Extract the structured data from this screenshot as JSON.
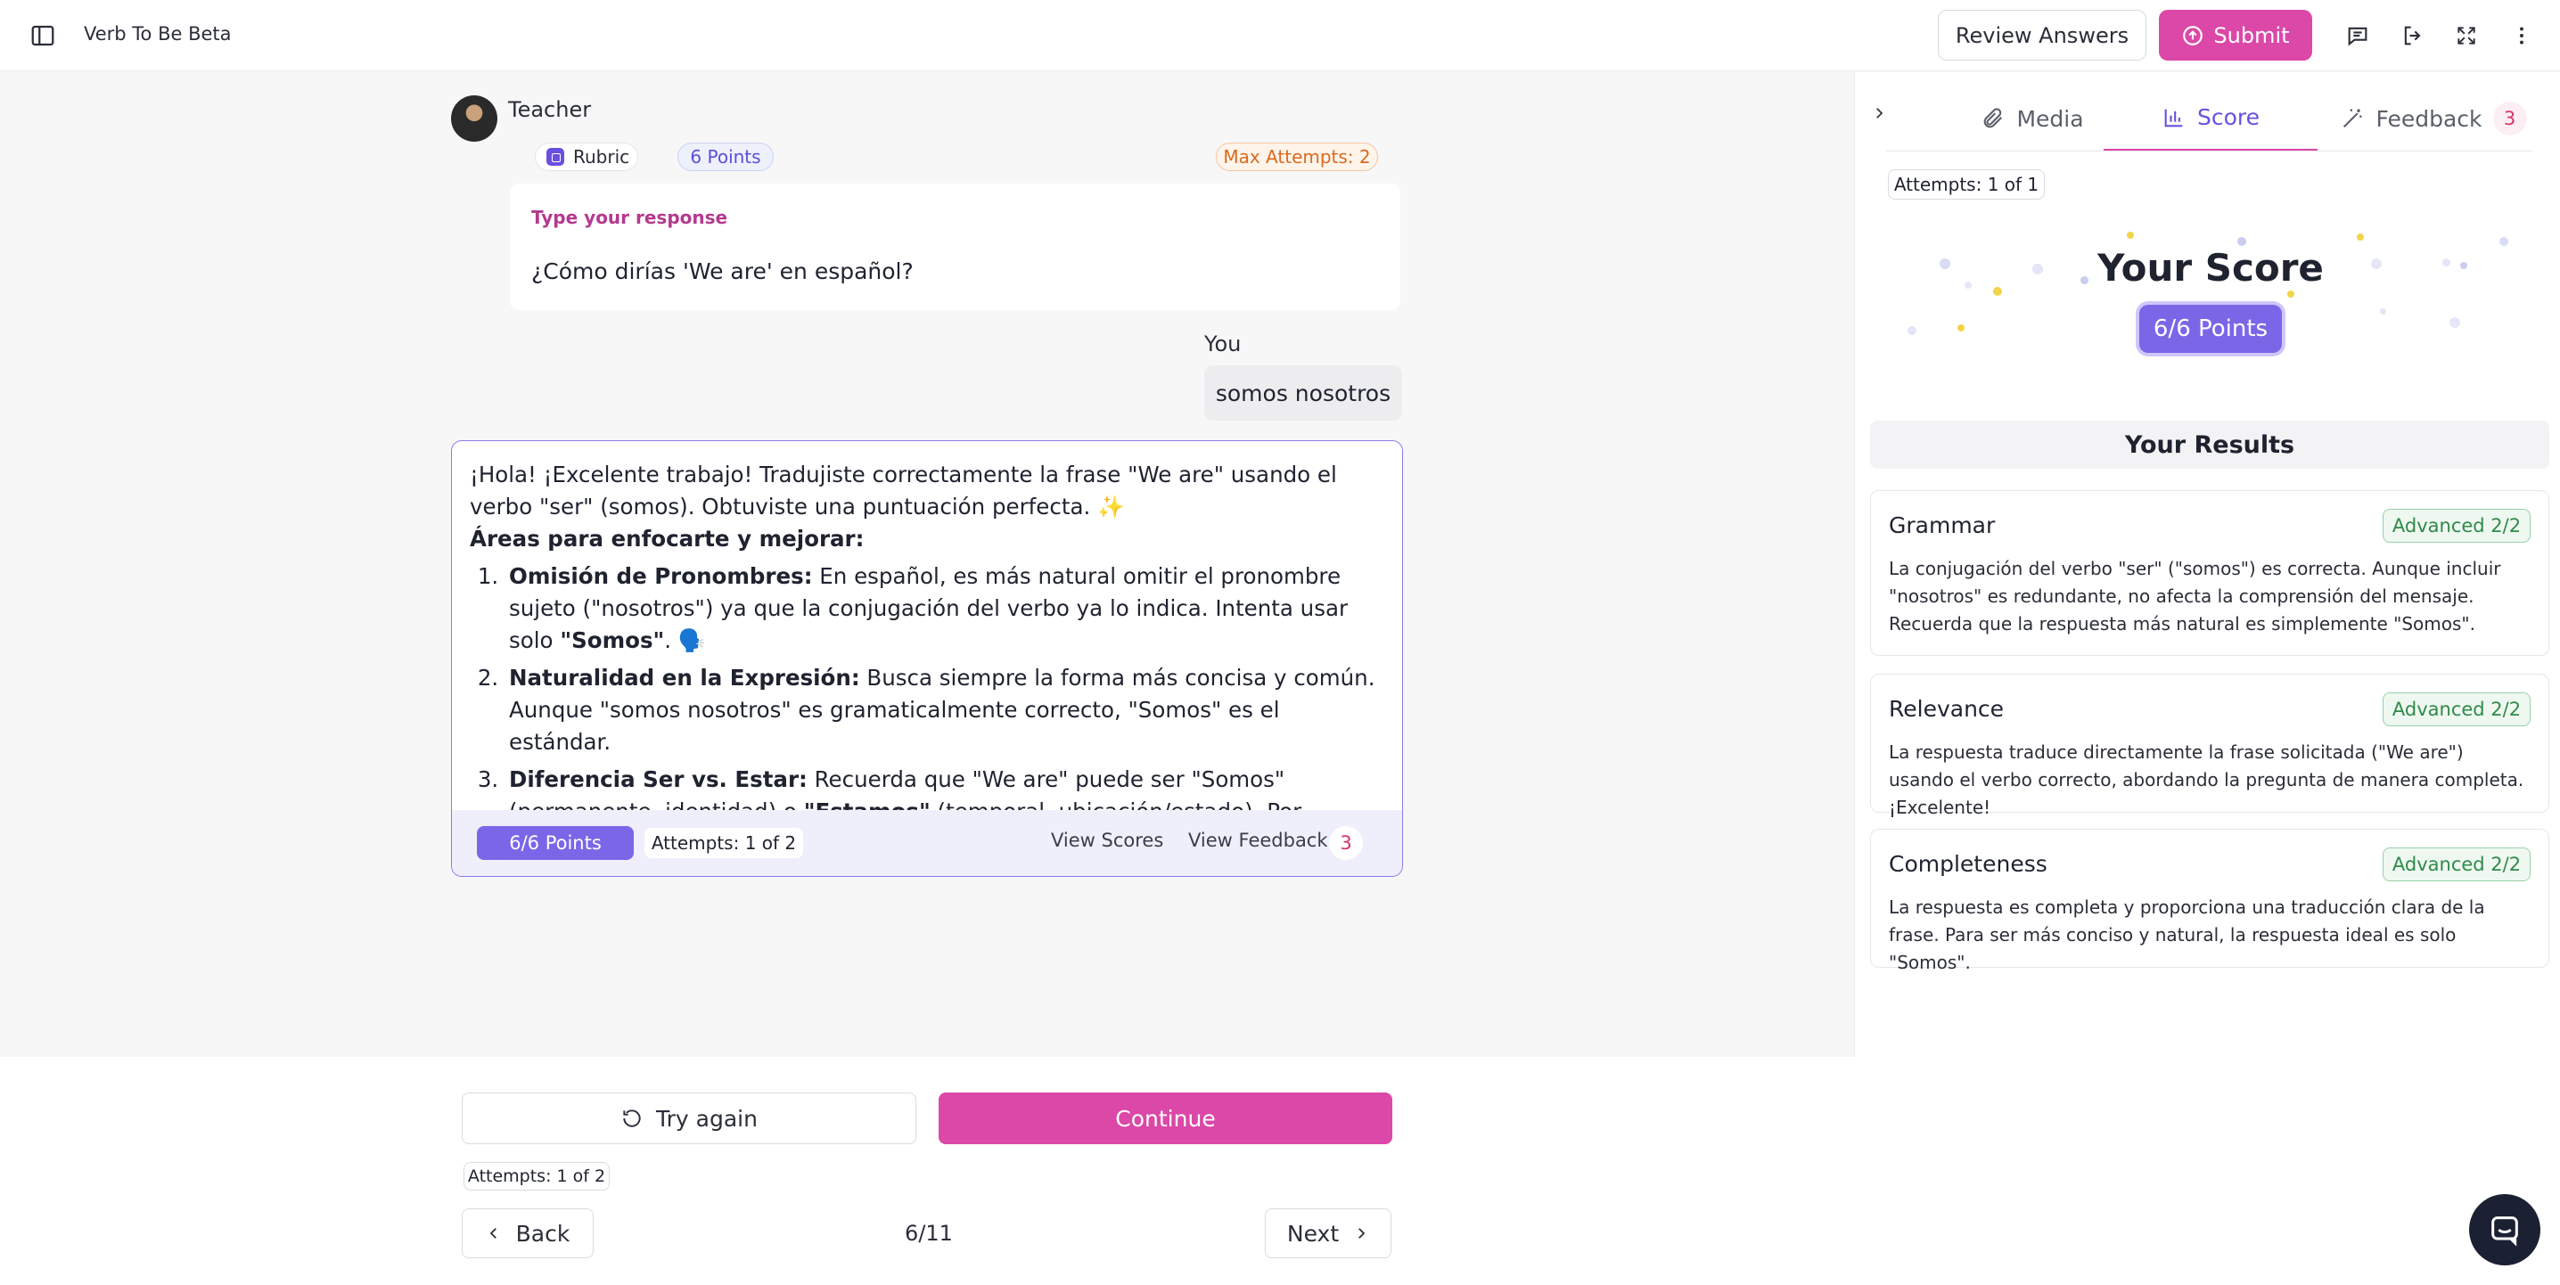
{
  "app": {
    "title": "Verb To Be Beta"
  },
  "header": {
    "review_label": "Review Answers",
    "submit_label": "Submit"
  },
  "question": {
    "author": "Teacher",
    "rubric_label": "Rubric",
    "points_label": "6 Points",
    "max_attempts_label": "Max Attempts: 2",
    "response_type_label": "Type your response",
    "text": "¿Cómo dirías 'We are' en español?"
  },
  "answer": {
    "author": "You",
    "text": "somos nosotros"
  },
  "feedback": {
    "intro": "¡Hola! ¡Excelente trabajo! Tradujiste correctamente la frase \"We are\" usando el verbo \"ser\" (somos). Obtuviste una puntuación perfecta. ✨",
    "focus_title": "Áreas para enfocarte y mejorar:",
    "items": [
      {
        "head": "Omisión de Pronombres:",
        "pre": " En español, es más natural omitir el pronombre sujeto (\"nosotros\") ya que la conjugación del verbo ya lo indica. Intenta usar solo ",
        "bold": "\"Somos\"",
        "post": ". 🗣️"
      },
      {
        "head": "Naturalidad en la Expresión:",
        "pre": " Busca siempre la forma más concisa y común. Aunque \"somos nosotros\" es gramaticalmente correcto, \"Somos\" es el estándar.",
        "bold": "",
        "post": ""
      },
      {
        "head": "Diferencia Ser vs. Estar:",
        "pre": " Recuerda que \"We are\" puede ser \"Somos\" (permanente, identidad) o ",
        "bold": "\"Estamos\"",
        "post": " (temporal, ubicación/estado). Por ejemplo, \"We are happy\" se dice \"Estamos felices\". ¡Sigue practicando! 🚀"
      }
    ],
    "footer": {
      "points": "6/6 Points",
      "attempts": "Attempts: 1 of 2",
      "view_scores": "View Scores",
      "view_feedback": "View Feedback",
      "feedback_count": "3"
    }
  },
  "controls": {
    "try_again": "Try again",
    "continue": "Continue",
    "attempts": "Attempts: 1 of 2",
    "back": "Back",
    "page": "6/11",
    "next": "Next"
  },
  "right_panel": {
    "tabs": [
      {
        "label": "Media",
        "icon": "paperclip-icon"
      },
      {
        "label": "Score",
        "icon": "bar-chart-icon",
        "active": true
      },
      {
        "label": "Feedback",
        "icon": "magic-wand-icon",
        "badge": "3"
      }
    ],
    "attempts": "Attempts: 1 of 1",
    "score_title": "Your Score",
    "score_value": "6/6 Points",
    "results_title": "Your Results",
    "results": [
      {
        "name": "Grammar",
        "level": "Advanced 2/2",
        "text": "La conjugación del verbo \"ser\" (\"somos\") es correcta. Aunque incluir \"nosotros\" es redundante, no afecta la comprensión del mensaje. Recuerda que la respuesta más natural es simplemente \"Somos\"."
      },
      {
        "name": "Relevance",
        "level": "Advanced 2/2",
        "text": "La respuesta traduce directamente la frase solicitada (\"We are\") usando el verbo correcto, abordando la pregunta de manera completa. ¡Excelente!"
      },
      {
        "name": "Completeness",
        "level": "Advanced 2/2",
        "text": "La respuesta es completa y proporciona una traducción clara de la frase. Para ser más conciso y natural, la respuesta ideal es solo \"Somos\"."
      }
    ]
  },
  "colors": {
    "accent_pink": "#db48a8",
    "accent_purple": "#7b66e8",
    "success_green": "#2f8a4a"
  }
}
